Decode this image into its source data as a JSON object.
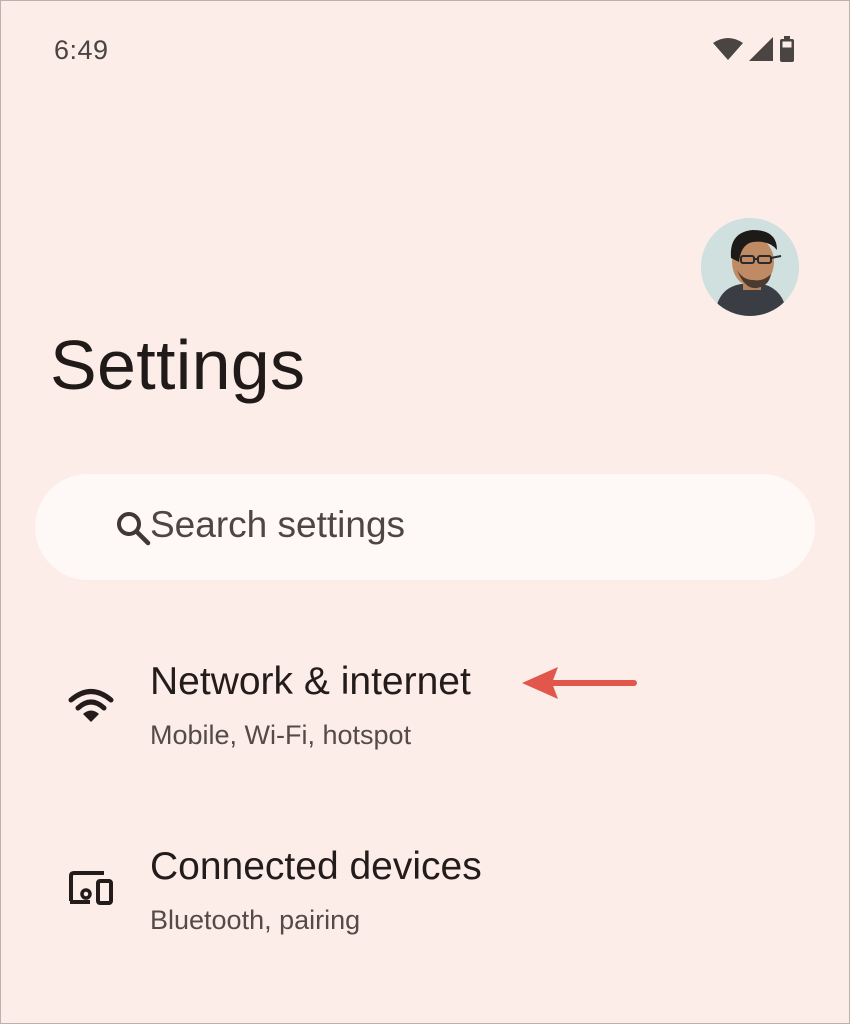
{
  "status_bar": {
    "time": "6:49",
    "icons": [
      "wifi-icon",
      "cellular-signal-icon",
      "battery-icon"
    ]
  },
  "header": {
    "title": "Settings",
    "avatar": "profile-avatar"
  },
  "search": {
    "placeholder": "Search settings",
    "icon": "search-icon"
  },
  "items": [
    {
      "title": "Network & internet",
      "subtitle": "Mobile, Wi-Fi, hotspot",
      "icon": "wifi-icon"
    },
    {
      "title": "Connected devices",
      "subtitle": "Bluetooth, pairing",
      "icon": "connected-devices-icon"
    }
  ],
  "annotation": {
    "type": "arrow",
    "color": "#e2574c",
    "points_to": "Network & internet"
  },
  "colors": {
    "background": "#fcede9",
    "search_background": "#fef8f6",
    "text_primary": "#231c1a",
    "text_secondary": "#544b49"
  }
}
